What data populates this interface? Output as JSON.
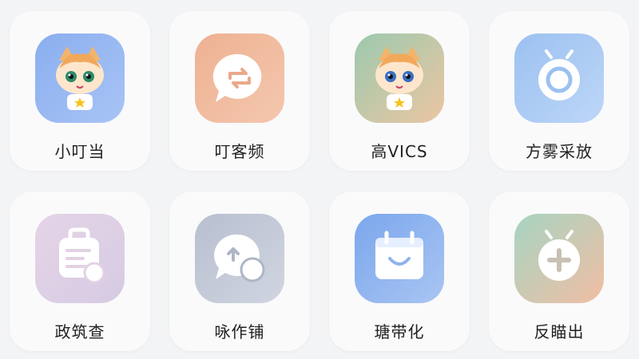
{
  "apps": [
    {
      "label": "小叮当",
      "icon": "cat-mascot-icon",
      "colors": [
        "#8fb1ef",
        "#a5c2f5"
      ]
    },
    {
      "label": "叮客频",
      "icon": "sync-chat-icon",
      "colors": [
        "#efb394",
        "#f3c4ab"
      ]
    },
    {
      "label": "高VICS",
      "icon": "cat-mascot-icon",
      "colors": [
        "#9ec8b0",
        "#e8c6a4"
      ]
    },
    {
      "label": "方雾采放",
      "icon": "ring-antenna-icon",
      "colors": [
        "#9fc3f1",
        "#b9d4f6"
      ]
    },
    {
      "label": "政筑查",
      "icon": "clipboard-chat-icon",
      "colors": [
        "#e3d4e6",
        "#d8cce4"
      ]
    },
    {
      "label": "咏作铺",
      "icon": "upload-chat-icon",
      "colors": [
        "#b9c0cf",
        "#cfd4df"
      ]
    },
    {
      "label": "瑭带化",
      "icon": "calendar-box-icon",
      "colors": [
        "#7ea9ec",
        "#a7c3f3"
      ]
    },
    {
      "label": "反瞄出",
      "icon": "plus-antenna-icon",
      "colors": [
        "#a5d3c2",
        "#f0bfa6"
      ]
    }
  ]
}
